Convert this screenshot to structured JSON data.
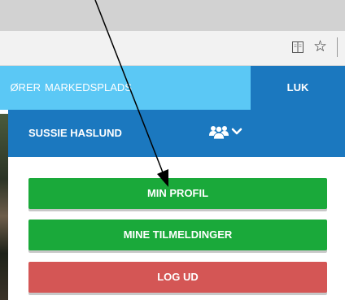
{
  "browser": {
    "reading_view_icon": "reading-view-icon",
    "favorite_icon": "star-icon",
    "favorite_glyph": "☆"
  },
  "nav": {
    "partial_item": "ØRER",
    "market_label": "MARKEDSPLADS",
    "close_label": "LUK"
  },
  "user": {
    "name": "SUSSIE HASLUND",
    "users_icon": "users-icon",
    "dropdown_icon": "chevron-down-icon"
  },
  "menu": {
    "profile_label": "MIN PROFIL",
    "signups_label": "MINE TILMELDINGER",
    "logout_label": "LOG UD"
  },
  "colors": {
    "nav_bg": "#5bc8f5",
    "header_bg": "#1b78bf",
    "primary_button": "#1aa93a",
    "logout_button": "#d45655"
  }
}
